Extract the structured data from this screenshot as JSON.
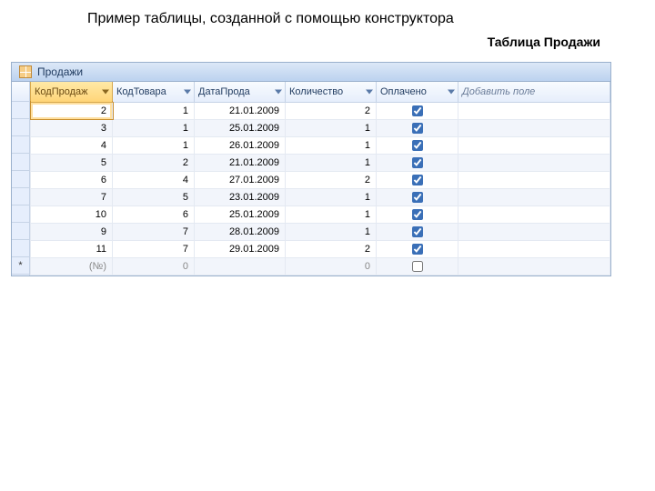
{
  "heading": "Пример таблицы, созданной с помощью конструктора",
  "subheading": "Таблица Продажи",
  "tab_title": "Продажи",
  "columns": {
    "id": "КодПродаж",
    "prod": "КодТовара",
    "date": "ДатаПрода",
    "qty": "Количество",
    "paid": "Оплачено",
    "add": "Добавить поле"
  },
  "rows": [
    {
      "id": "2",
      "prod": "1",
      "date": "21.01.2009",
      "qty": "2",
      "paid": true
    },
    {
      "id": "3",
      "prod": "1",
      "date": "25.01.2009",
      "qty": "1",
      "paid": true
    },
    {
      "id": "4",
      "prod": "1",
      "date": "26.01.2009",
      "qty": "1",
      "paid": true
    },
    {
      "id": "5",
      "prod": "2",
      "date": "21.01.2009",
      "qty": "1",
      "paid": true
    },
    {
      "id": "6",
      "prod": "4",
      "date": "27.01.2009",
      "qty": "2",
      "paid": true
    },
    {
      "id": "7",
      "prod": "5",
      "date": "23.01.2009",
      "qty": "1",
      "paid": true
    },
    {
      "id": "10",
      "prod": "6",
      "date": "25.01.2009",
      "qty": "1",
      "paid": true
    },
    {
      "id": "9",
      "prod": "7",
      "date": "28.01.2009",
      "qty": "1",
      "paid": true
    },
    {
      "id": "11",
      "prod": "7",
      "date": "29.01.2009",
      "qty": "2",
      "paid": true
    }
  ],
  "newrow": {
    "id": "(№)",
    "prod": "0",
    "date": "",
    "qty": "0",
    "paid": false,
    "marker": "*"
  }
}
